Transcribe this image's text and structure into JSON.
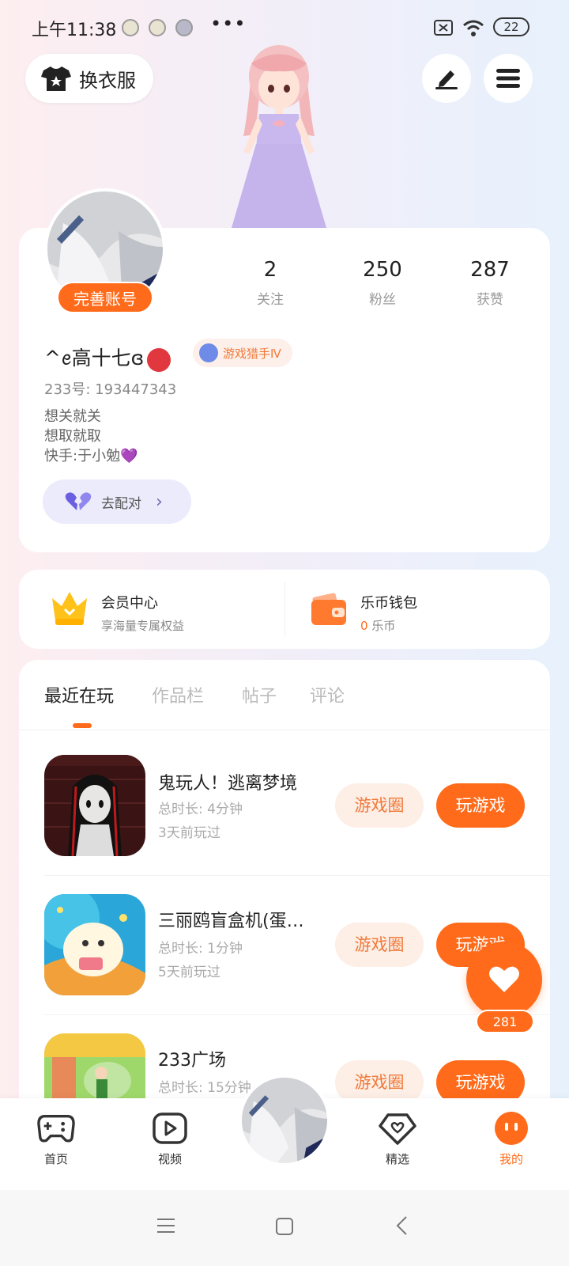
{
  "status_bar": {
    "time": "上午11:38",
    "more": "•••",
    "battery": "22"
  },
  "top_bar": {
    "outfit_label": "换衣服",
    "edit_icon": "pen-icon",
    "menu_icon": "hamburger-menu-icon"
  },
  "profile": {
    "complete_account_label": "完善账号",
    "stats": [
      {
        "value": "2",
        "label": "关注"
      },
      {
        "value": "250",
        "label": "粉丝"
      },
      {
        "value": "287",
        "label": "获赞"
      }
    ],
    "username": "^ꫀ高十七ɞ",
    "level_badge": "游戏猎手Ⅳ",
    "account_id": "233号: 193447343",
    "bio": [
      "想关就关",
      "想取就取",
      "快手:于小勉💜"
    ],
    "match_label": "去配对"
  },
  "vip": {
    "member_title": "会员中心",
    "member_sub": "享海量专属权益",
    "wallet_title": "乐币钱包",
    "wallet_amount": "0",
    "wallet_unit": "乐币"
  },
  "tabs": [
    {
      "label": "最近在玩",
      "active": true
    },
    {
      "label": "作品栏",
      "active": false
    },
    {
      "label": "帖子",
      "active": false
    },
    {
      "label": "评论",
      "active": false
    }
  ],
  "games": [
    {
      "title": "鬼玩人！逃离梦境",
      "duration": "总时长: 4分钟",
      "last_played": "3天前玩过",
      "circle_label": "游戏圈",
      "play_label": "玩游戏"
    },
    {
      "title": "三丽鸥盲盒机(蛋…",
      "duration": "总时长: 1分钟",
      "last_played": "5天前玩过",
      "circle_label": "游戏圈",
      "play_label": "玩游戏"
    },
    {
      "title": "233广场",
      "duration": "总时长: 15分钟",
      "last_played": "",
      "circle_label": "游戏圈",
      "play_label": "玩游戏"
    }
  ],
  "like_fab": {
    "count": "281"
  },
  "bottom_nav": [
    {
      "label": "首页",
      "icon": "gamepad-icon",
      "active": false
    },
    {
      "label": "视频",
      "icon": "play-video-icon",
      "active": false
    },
    {
      "label": "精选",
      "icon": "heart-box-icon",
      "active": false
    },
    {
      "label": "我的",
      "icon": "face-icon",
      "active": true
    }
  ],
  "colors": {
    "accent": "#ff6b1a",
    "accent_light": "#fdeee6",
    "purple_light": "#ecebfb"
  }
}
